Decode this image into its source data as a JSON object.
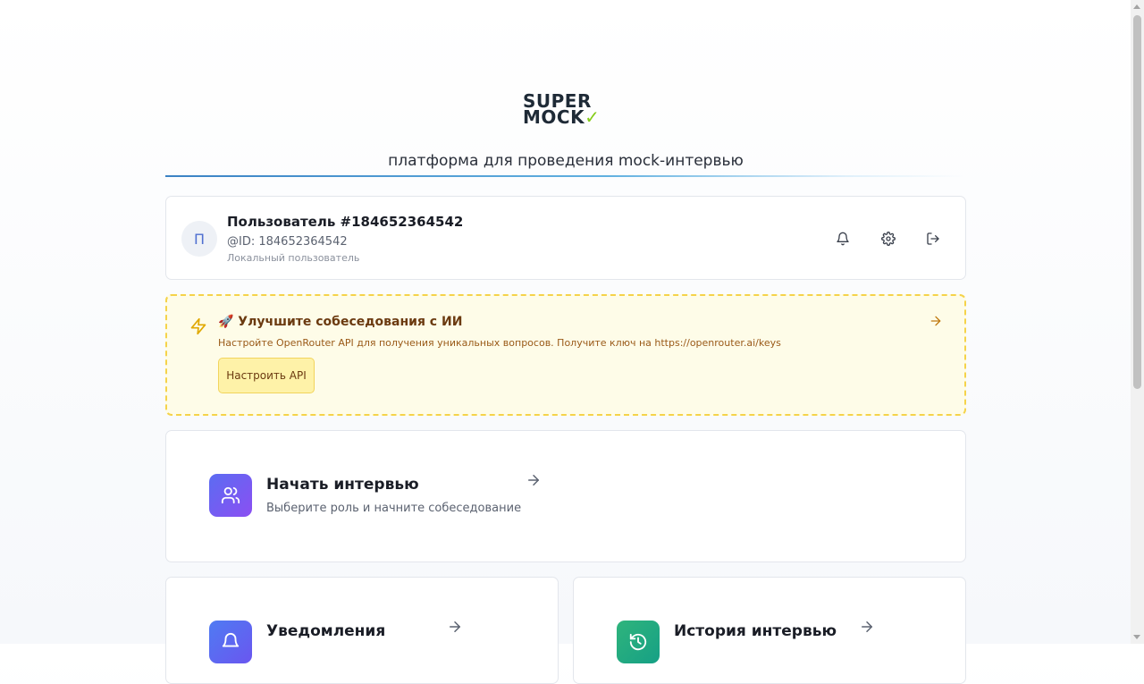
{
  "brand": {
    "logo_line1": "SUPER",
    "logo_line2": "MOCK",
    "tagline": "платформа для проведения mock-интервью"
  },
  "user": {
    "avatar_letter": "П",
    "name": "Пользователь #184652364542",
    "id_text": "@ID: 184652364542",
    "type": "Локальный пользователь"
  },
  "api_banner": {
    "title": "🚀 Улучшите собеседования с ИИ",
    "description": "Настройте OpenRouter API для получения уникальных вопросов. Получите ключ на https://openrouter.ai/keys",
    "button_label": "Настроить API"
  },
  "start_interview": {
    "title": "Начать интервью",
    "subtitle": "Выберите роль и начните собеседование"
  },
  "notifications": {
    "title": "Уведомления"
  },
  "history": {
    "title": "История интервью"
  },
  "colors": {
    "accent_purple": "#7c5cf2",
    "banner_bg": "#fefce8",
    "banner_border": "#f5d34a",
    "logo_check": "#84cc16"
  }
}
